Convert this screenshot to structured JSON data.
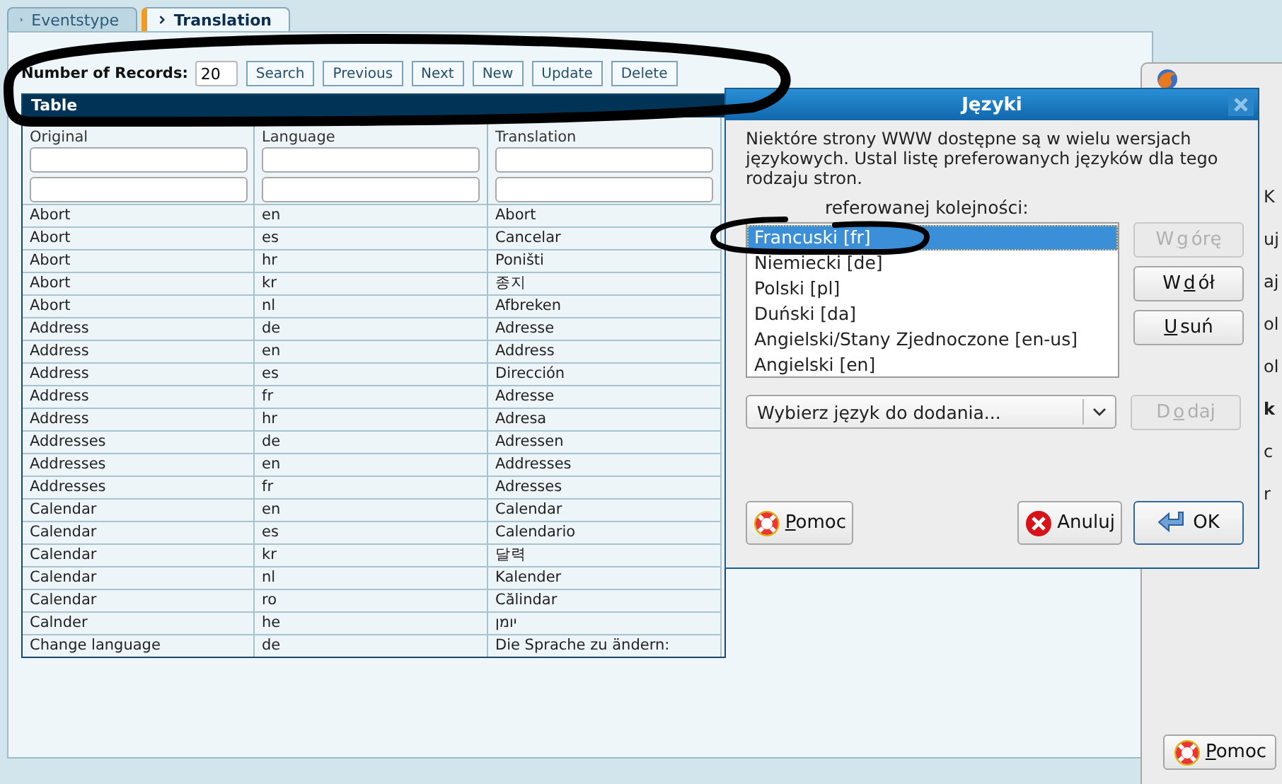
{
  "tabs": [
    {
      "label": "Eventstype",
      "selected": false
    },
    {
      "label": "Translation",
      "selected": true
    }
  ],
  "toolbar": {
    "records_label": "Number of Records:",
    "records_value": "20",
    "buttons": [
      "Search",
      "Previous",
      "Next",
      "New",
      "Update",
      "Delete"
    ]
  },
  "table": {
    "title": "Table",
    "columns": [
      "Original",
      "Language",
      "Translation"
    ],
    "rows": [
      [
        "Abort",
        "en",
        "Abort"
      ],
      [
        "Abort",
        "es",
        "Cancelar"
      ],
      [
        "Abort",
        "hr",
        "Poništi"
      ],
      [
        "Abort",
        "kr",
        "종지"
      ],
      [
        "Abort",
        "nl",
        "Afbreken"
      ],
      [
        "Address",
        "de",
        "Adresse"
      ],
      [
        "Address",
        "en",
        "Address"
      ],
      [
        "Address",
        "es",
        "Dirección"
      ],
      [
        "Address",
        "fr",
        "Adresse"
      ],
      [
        "Address",
        "hr",
        "Adresa"
      ],
      [
        "Addresses",
        "de",
        "Adressen"
      ],
      [
        "Addresses",
        "en",
        "Addresses"
      ],
      [
        "Addresses",
        "fr",
        "Adresses"
      ],
      [
        "Calendar",
        "en",
        "Calendar"
      ],
      [
        "Calendar",
        "es",
        "Calendario"
      ],
      [
        "Calendar",
        "kr",
        "달력"
      ],
      [
        "Calendar",
        "nl",
        "Kalender"
      ],
      [
        "Calendar",
        "ro",
        "Călindar"
      ],
      [
        "Calnder",
        "he",
        "יומן"
      ],
      [
        "Change language",
        "de",
        "Die Sprache zu ändern:"
      ]
    ]
  },
  "dialog": {
    "title": "Języki",
    "description": "Niektóre strony WWW dostępne są w wielu wersjach językowych. Ustal listę preferowanych języków dla tego rodzaju stron.",
    "list_label": "referowanej kolejności:",
    "languages": [
      {
        "label": "Francuski  [fr]",
        "selected": true
      },
      {
        "label": "Niemiecki  [de]",
        "selected": false
      },
      {
        "label": "Polski  [pl]",
        "selected": false
      },
      {
        "label": "Duński  [da]",
        "selected": false
      },
      {
        "label": "Angielski/Stany Zjednoczone  [en-us]",
        "selected": false
      },
      {
        "label": "Angielski  [en]",
        "selected": false
      }
    ],
    "side_buttons": [
      {
        "label": [
          {
            "text": "W ",
            "underline": false
          },
          {
            "text": "g",
            "underline": true
          },
          {
            "text": "órę",
            "underline": false
          }
        ],
        "disabled": true
      },
      {
        "label": [
          {
            "text": "W ",
            "underline": false
          },
          {
            "text": "d",
            "underline": true
          },
          {
            "text": "ół",
            "underline": false
          }
        ],
        "disabled": false
      },
      {
        "label": [
          {
            "text": "U",
            "underline": true
          },
          {
            "text": "suń",
            "underline": false
          }
        ],
        "disabled": false
      }
    ],
    "add_select": {
      "value": "Wybierz język do dodania..."
    },
    "add_button": {
      "label": [
        {
          "text": "D",
          "underline": false
        },
        {
          "text": "o",
          "underline": true
        },
        {
          "text": "daj",
          "underline": false
        }
      ],
      "disabled": true
    },
    "bottom_buttons": [
      {
        "kind": "help",
        "label": [
          {
            "text": "P",
            "underline": true
          },
          {
            "text": "omoc",
            "underline": false
          }
        ]
      },
      {
        "kind": "cancel",
        "label": [
          {
            "text": "Anuluj",
            "underline": false
          }
        ]
      },
      {
        "kind": "ok",
        "label": [
          {
            "text": "OK",
            "underline": false
          }
        ]
      }
    ]
  },
  "background_window": {
    "fragments": [
      {
        "text": "K",
        "bold": false
      },
      {
        "text": "uj",
        "bold": false
      },
      {
        "text": "aj",
        "bold": false
      },
      {
        "text": "ol",
        "bold": false
      },
      {
        "text": "ol",
        "bold": false
      },
      {
        "text": "k",
        "bold": true
      },
      {
        "text": "c",
        "bold": false
      },
      {
        "text": "r",
        "bold": false
      }
    ],
    "help_button": {
      "label": [
        {
          "text": "P",
          "underline": true
        },
        {
          "text": "omoc",
          "underline": false
        }
      ]
    }
  }
}
